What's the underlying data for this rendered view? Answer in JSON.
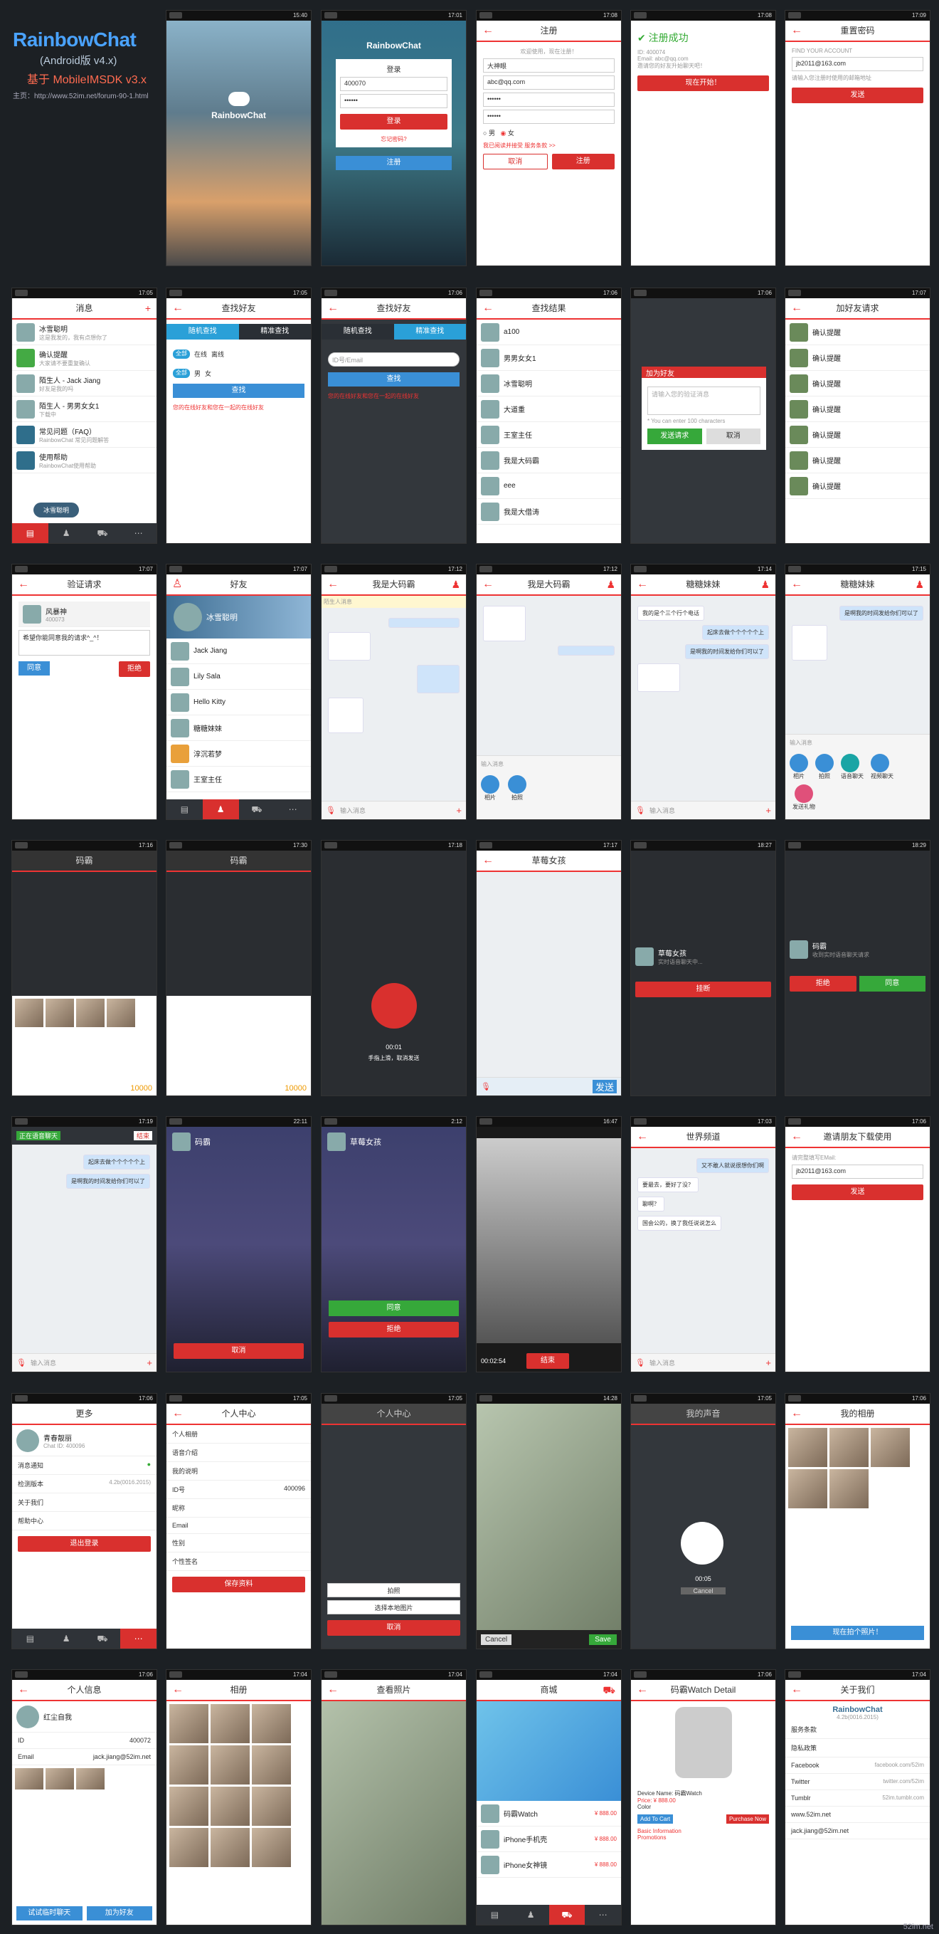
{
  "intro": {
    "title": "RainbowChat",
    "subtitle": "(Android版 v4.x)",
    "based": "基于 MobileIMSDK v3.x",
    "home": "主页：http://www.52im.net/forum-90-1.html"
  },
  "status_time": [
    "15:40",
    "17:01",
    "17:08",
    "17:08",
    "17:09",
    "17:05",
    "17:05",
    "17:06",
    "17:06",
    "17:06",
    "17:07",
    "17:07",
    "17:07",
    "17:12",
    "17:12",
    "17:14",
    "17:15",
    "17:16",
    "17:30",
    "17:18",
    "17:17",
    "18:27",
    "18:29",
    "17:19",
    "22:11",
    "2:12",
    "16:47",
    "17:03",
    "17:06",
    "17:06",
    "17:05",
    "17:05",
    "14:28",
    "17:05",
    "17:06",
    "17:06",
    "17:04",
    "17:04",
    "17:04"
  ],
  "app_name": "RainbowChat",
  "login": {
    "title": "登录",
    "account": "400070",
    "password": "••••••",
    "btn": "登录",
    "forgot": "忘记密码?",
    "register": "注册"
  },
  "register": {
    "title": "注册",
    "welcome": "欢迎使用，现在注册！",
    "nick": "大神眼",
    "email": "abc@qq.com",
    "pw": "••••••",
    "pw2": "••••••",
    "male": "男",
    "female": "女",
    "agree": "我已阅读并接受 服务条款 >>",
    "cancel": "取消",
    "ok": "注册"
  },
  "regok": {
    "title": "注册成功",
    "id": "ID: 400074",
    "email": "Email: abc@qq.com",
    "tip": "邀请您的好友升始聊天吧！",
    "btn": "现在开始！"
  },
  "reset": {
    "title": "重置密码",
    "find": "FIND YOUR ACCOUNT",
    "email": "jb2011@163.com",
    "tip": "请输入您注册时使用的邮箱地址",
    "btn": "发送"
  },
  "msg": {
    "title": "消息",
    "items": [
      {
        "name": "冰雪聪明",
        "sub": "这是我发的，我有点想你了"
      },
      {
        "name": "确认提醒",
        "sub": "大家请不要重复确认"
      },
      {
        "name": "陌生人 - Jack Jiang",
        "sub": "好友是我的吗"
      },
      {
        "name": "陌生人 - 男男女女1",
        "sub": "下载中"
      },
      {
        "name": "常见问题（FAQ）",
        "sub": "RainbowChat 常见问题解答"
      },
      {
        "name": "使用帮助",
        "sub": "RainbowChat使用帮助"
      }
    ],
    "float": "冰雪聪明"
  },
  "find": {
    "title": "查找好友",
    "tab1": "随机查找",
    "tab2": "精准查找",
    "online": "在线",
    "offline": "离线",
    "all": "全部",
    "male": "男",
    "female": "女",
    "btn": "查找",
    "tip": "您的在线好友和您在一起的在线好友",
    "ph": "ID号/Email"
  },
  "results": {
    "title": "查找结果",
    "items": [
      "a100",
      "男男女女1",
      "冰雪聪明",
      "大道重",
      "王室主任",
      "我是大码霸",
      "eee",
      "我是大借涛"
    ]
  },
  "addfriend": {
    "title": "加为好友",
    "ph": "请输入您的验证消息",
    "send": "发送请求",
    "cancel": "取消",
    "tip": "* You can enter 100 characters"
  },
  "req": {
    "title": "加好友请求",
    "items": [
      "确认提醒",
      "确认提醒",
      "确认提醒",
      "确认提醒",
      "确认提醒",
      "确认提醒",
      "确认提醒"
    ]
  },
  "verify": {
    "title": "验证请求",
    "name": "风暴神",
    "id": "400073",
    "msg": "希望你能同意我的请求^_^！",
    "agree": "同意",
    "reject": "拒绝"
  },
  "friends": {
    "title": "好友",
    "me": "冰雪聪明",
    "items": [
      "Jack Jiang",
      "Lily Sala",
      "Hello Kitty",
      "糖糖妹妹",
      "淳沉若梦",
      "王室主任"
    ]
  },
  "chat1": {
    "title": "我是大码霸",
    "sub": "[在线]",
    "tip": "陌生人消息",
    "input": "输入消息"
  },
  "chat2": {
    "title": "我是大码霸",
    "sub": "[在线]",
    "input": "输入消息",
    "photo": "相片",
    "camera": "拍照"
  },
  "chat3": {
    "title": "糖糖妹妹",
    "input": "输入消息",
    "m1": "我的是个三个行个电话",
    "m2": "起床去做个个个个个上",
    "m3": "是啊我的时间发给你们可以了",
    "voice": "语音聊天",
    "video": "视频聊天",
    "gift": "发送礼物",
    "photo": "相片",
    "camera": "拍照",
    "send_file": "发送礼物"
  },
  "gift": {
    "title": "码霸",
    "tip": "10000"
  },
  "voice_rec": {
    "time": "00:01",
    "tip": "手指上滑，取消发送"
  },
  "chat4": {
    "title": "草莓女孩",
    "sub": "[在线]",
    "send": "发送"
  },
  "call_out": {
    "name": "草莓女孩",
    "sub": "实时语音聊天中...",
    "btn": "挂断"
  },
  "call_in": {
    "name": "码霸",
    "sub": "收到实时语音聊天请求",
    "reject": "拒绝",
    "accept": "同意"
  },
  "voice_top": {
    "notice": "正在语音聊天",
    "end": "结束"
  },
  "vcall_out": {
    "name": "码霸",
    "cancel": "取消"
  },
  "vcall_in": {
    "name": "草莓女孩",
    "accept": "同意",
    "reject": "拒绝"
  },
  "vcall": {
    "time": "00:02:54",
    "end": "结束"
  },
  "world": {
    "title": "世界频道",
    "m1": "又不敢人就说很想你们啊",
    "m2": "要最去，要好了没？",
    "m3": "聊啊？",
    "m4": "国会公的，换了我任说说怎么",
    "input": "输入消息"
  },
  "invite": {
    "title": "邀请朋友下载使用",
    "tip": "请完整填写EMail:",
    "email": "jb2011@163.com",
    "btn": "发送"
  },
  "more": {
    "title": "更多",
    "name": "青春靓丽",
    "id": "Chat ID: 400096",
    "items": [
      "消息通知",
      "检测版本",
      "关于我们",
      "帮助中心"
    ],
    "version": "4.2b(0016.2015)",
    "logout": "退出登录"
  },
  "ucenter": {
    "title": "个人中心",
    "items": [
      "个人相册",
      "语音介绍",
      "我的说明",
      "ID号",
      "昵称",
      "Email",
      "性别",
      "个性签名"
    ],
    "id": "400096",
    "save": "保存资料"
  },
  "ucenter_dlg": {
    "title": "个人中心",
    "take": "拍照",
    "choose": "选择本地图片",
    "cancel": "取消"
  },
  "crop": {
    "cancel": "Cancel",
    "save": "Save"
  },
  "myvoice": {
    "title": "我的声音",
    "time": "00:05",
    "cancel": "Cancel"
  },
  "album": {
    "title": "我的相册",
    "btn": "现在拍个照片！"
  },
  "pinfo": {
    "title": "个人信息",
    "name": "红尘自我",
    "id": "400072",
    "email": "jack.jiang@52im.net",
    "add": "加为好友",
    "chat": "试试临时聊天"
  },
  "pics": {
    "title": "相册"
  },
  "viewpic": {
    "title": "查看照片"
  },
  "shop": {
    "title": "商城",
    "items": [
      {
        "name": "码霸Watch",
        "price": "¥ 888.00"
      },
      {
        "name": "iPhone手机壳",
        "price": "¥ 888.00"
      },
      {
        "name": "iPhone女神镜",
        "price": "¥ 888.00"
      }
    ]
  },
  "watch": {
    "title": "码霸Watch Detail",
    "device": "Device Name: 码霸Watch",
    "price": "Price: ¥ 888.00",
    "color": "Color",
    "add": "Add To Cart",
    "buy": "Purchase Now",
    "basic": "Basic Information",
    "promo": "Promotions"
  },
  "about": {
    "title": "关于我们",
    "ver": "4.2b(0016.2015)",
    "items": [
      "服务条款",
      "隐私政策"
    ],
    "fb": "Facebook",
    "tw": "Twitter",
    "tb": "Tumblr",
    "web": "www.52im.net",
    "mail": "jack.jiang@52im.net",
    "link1": "facebook.com/52im",
    "link2": "twitter.com/52im",
    "link3": "52im.tumblr.com"
  },
  "footer": "52im.net"
}
